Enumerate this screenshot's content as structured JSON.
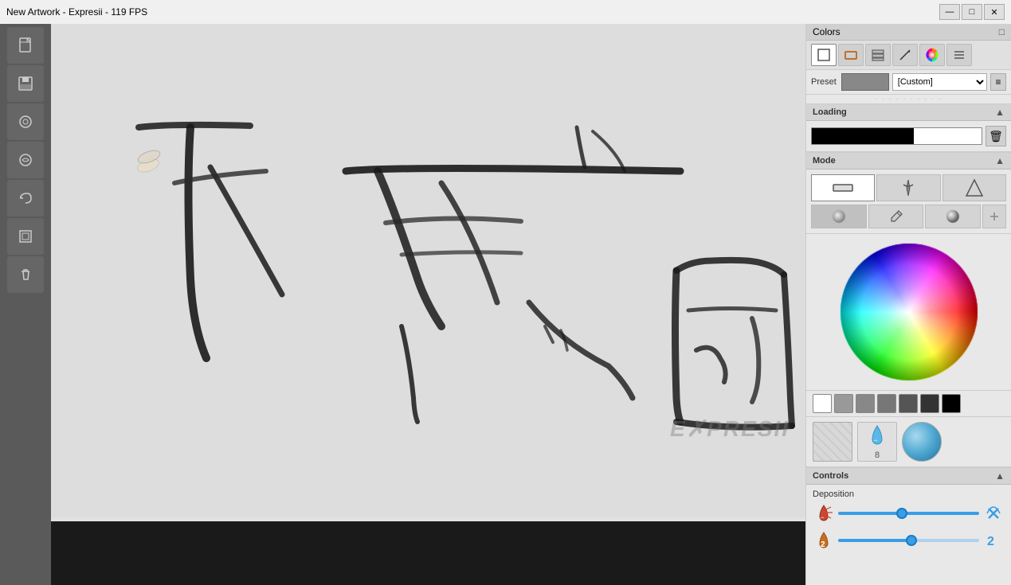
{
  "titleBar": {
    "title": "New Artwork - Expresii - 119 FPS",
    "minBtn": "—",
    "maxBtn": "□",
    "closeBtn": "✕"
  },
  "rightPanel": {
    "colorsTitle": "Colors",
    "presetLabel": "Preset",
    "presetValue": "[Custom]",
    "dividerDots": "· · · · · · · · · ·",
    "loadingTitle": "Loading",
    "modeTitle": "Mode",
    "controlsTitle": "Controls",
    "depositionLabel": "Deposition",
    "waterDropNumber": "8"
  },
  "toolIcons": [
    {
      "name": "canvas-icon",
      "symbol": "□"
    },
    {
      "name": "brush-square-icon",
      "symbol": "⬜"
    },
    {
      "name": "layers-icon",
      "symbol": "◫"
    },
    {
      "name": "pen-icon",
      "symbol": "✒"
    },
    {
      "name": "color-circle-icon",
      "symbol": "◉"
    },
    {
      "name": "menu-icon",
      "symbol": "≡"
    }
  ],
  "leftTools": [
    {
      "name": "new-file-icon",
      "symbol": "📄"
    },
    {
      "name": "save-icon",
      "symbol": "💾"
    },
    {
      "name": "brush-tool-icon",
      "symbol": "⬤"
    },
    {
      "name": "edit-tool-icon",
      "symbol": "✏"
    },
    {
      "name": "undo-icon",
      "symbol": "↩"
    },
    {
      "name": "layer-icon",
      "symbol": "▣"
    },
    {
      "name": "delete-icon",
      "symbol": "🗑"
    }
  ],
  "swatches": [
    {
      "color": "#ffffff",
      "name": "white"
    },
    {
      "color": "#888888",
      "name": "gray1"
    },
    {
      "color": "#999999",
      "name": "gray2"
    },
    {
      "color": "#aaaaaa",
      "name": "gray3"
    },
    {
      "color": "#555555",
      "name": "gray4"
    },
    {
      "color": "#1a1a1a",
      "name": "black"
    },
    {
      "color": "#000000",
      "name": "black2"
    }
  ],
  "watermark": "E✗PRESII"
}
